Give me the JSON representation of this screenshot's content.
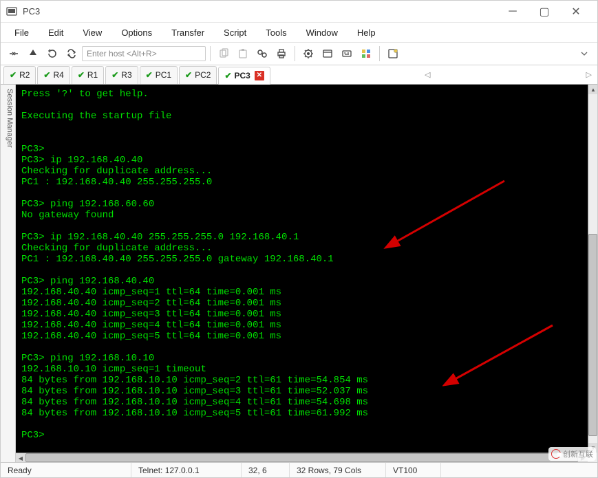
{
  "window": {
    "title": "PC3",
    "minimize_glyph": "─",
    "maximize_glyph": "▢",
    "close_glyph": "✕"
  },
  "menu": {
    "items": [
      "File",
      "Edit",
      "View",
      "Options",
      "Transfer",
      "Script",
      "Tools",
      "Window",
      "Help"
    ]
  },
  "toolbar": {
    "host_placeholder": "Enter host <Alt+R>"
  },
  "sidebar": {
    "label": "Session Manager"
  },
  "tabs": {
    "items": [
      {
        "label": "R2",
        "active": false
      },
      {
        "label": "R4",
        "active": false
      },
      {
        "label": "R1",
        "active": false
      },
      {
        "label": "R3",
        "active": false
      },
      {
        "label": "PC1",
        "active": false
      },
      {
        "label": "PC2",
        "active": false
      },
      {
        "label": "PC3",
        "active": true
      }
    ],
    "nav_left": "◁",
    "nav_right": "▷"
  },
  "terminal": {
    "lines": [
      "Press '?' to get help.",
      "",
      "Executing the startup file",
      "",
      "",
      "PC3>",
      "PC3> ip 192.168.40.40",
      "Checking for duplicate address...",
      "PC1 : 192.168.40.40 255.255.255.0",
      "",
      "PC3> ping 192.168.60.60",
      "No gateway found",
      "",
      "PC3> ip 192.168.40.40 255.255.255.0 192.168.40.1",
      "Checking for duplicate address...",
      "PC1 : 192.168.40.40 255.255.255.0 gateway 192.168.40.1",
      "",
      "PC3> ping 192.168.40.40",
      "192.168.40.40 icmp_seq=1 ttl=64 time=0.001 ms",
      "192.168.40.40 icmp_seq=2 ttl=64 time=0.001 ms",
      "192.168.40.40 icmp_seq=3 ttl=64 time=0.001 ms",
      "192.168.40.40 icmp_seq=4 ttl=64 time=0.001 ms",
      "192.168.40.40 icmp_seq=5 ttl=64 time=0.001 ms",
      "",
      "PC3> ping 192.168.10.10",
      "192.168.10.10 icmp_seq=1 timeout",
      "84 bytes from 192.168.10.10 icmp_seq=2 ttl=61 time=54.854 ms",
      "84 bytes from 192.168.10.10 icmp_seq=3 ttl=61 time=52.037 ms",
      "84 bytes from 192.168.10.10 icmp_seq=4 ttl=61 time=54.698 ms",
      "84 bytes from 192.168.10.10 icmp_seq=5 ttl=61 time=61.992 ms",
      "",
      "PC3>"
    ]
  },
  "status": {
    "ready": "Ready",
    "connection": "Telnet: 127.0.0.1",
    "cursor": "32,   6",
    "size": "32 Rows, 79 Cols",
    "emulation": "VT100"
  },
  "watermark": "创新互联"
}
